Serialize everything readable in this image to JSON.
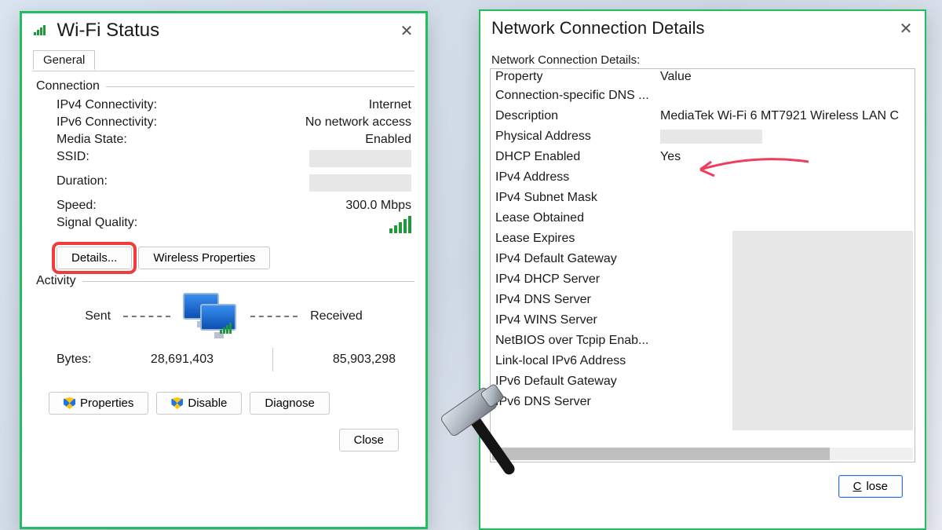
{
  "status": {
    "title": "Wi-Fi Status",
    "tab": "General",
    "section_connection": "Connection",
    "rows": {
      "ipv4_k": "IPv4 Connectivity:",
      "ipv4_v": "Internet",
      "ipv6_k": "IPv6 Connectivity:",
      "ipv6_v": "No network access",
      "media_k": "Media State:",
      "media_v": "Enabled",
      "ssid_k": "SSID:",
      "ssid_v": "",
      "dur_k": "Duration:",
      "dur_v": "",
      "speed_k": "Speed:",
      "speed_v": "300.0 Mbps",
      "sigq_k": "Signal Quality:"
    },
    "buttons": {
      "details": "Details...",
      "wireless_props": "Wireless Properties",
      "properties": "Properties",
      "disable": "Disable",
      "diagnose": "Diagnose",
      "close": "Close"
    },
    "section_activity": "Activity",
    "activity": {
      "sent_label": "Sent",
      "received_label": "Received",
      "bytes_label": "Bytes:",
      "bytes_sent": "28,691,403",
      "bytes_received": "85,903,298"
    }
  },
  "details": {
    "title": "Network Connection Details",
    "subtitle": "Network Connection Details:",
    "header_property": "Property",
    "header_value": "Value",
    "rows": [
      {
        "k": "Connection-specific DNS ...",
        "v": ""
      },
      {
        "k": "Description",
        "v": "MediaTek Wi-Fi 6 MT7921 Wireless LAN C"
      },
      {
        "k": "Physical Address",
        "v": "[redacted]"
      },
      {
        "k": "DHCP Enabled",
        "v": "Yes"
      },
      {
        "k": "IPv4 Address",
        "v": ""
      },
      {
        "k": "IPv4 Subnet Mask",
        "v": ""
      },
      {
        "k": "Lease Obtained",
        "v": ""
      },
      {
        "k": "Lease Expires",
        "v": ""
      },
      {
        "k": "IPv4 Default Gateway",
        "v": ""
      },
      {
        "k": "IPv4 DHCP Server",
        "v": ""
      },
      {
        "k": "IPv4 DNS Server",
        "v": ""
      },
      {
        "k": "IPv4 WINS Server",
        "v": ""
      },
      {
        "k": "NetBIOS over Tcpip Enab...",
        "v": ""
      },
      {
        "k": "Link-local IPv6 Address",
        "v": ""
      },
      {
        "k": "IPv6 Default Gateway",
        "v": ""
      },
      {
        "k": "IPv6 DNS Server",
        "v": ""
      }
    ],
    "close": "Close"
  }
}
